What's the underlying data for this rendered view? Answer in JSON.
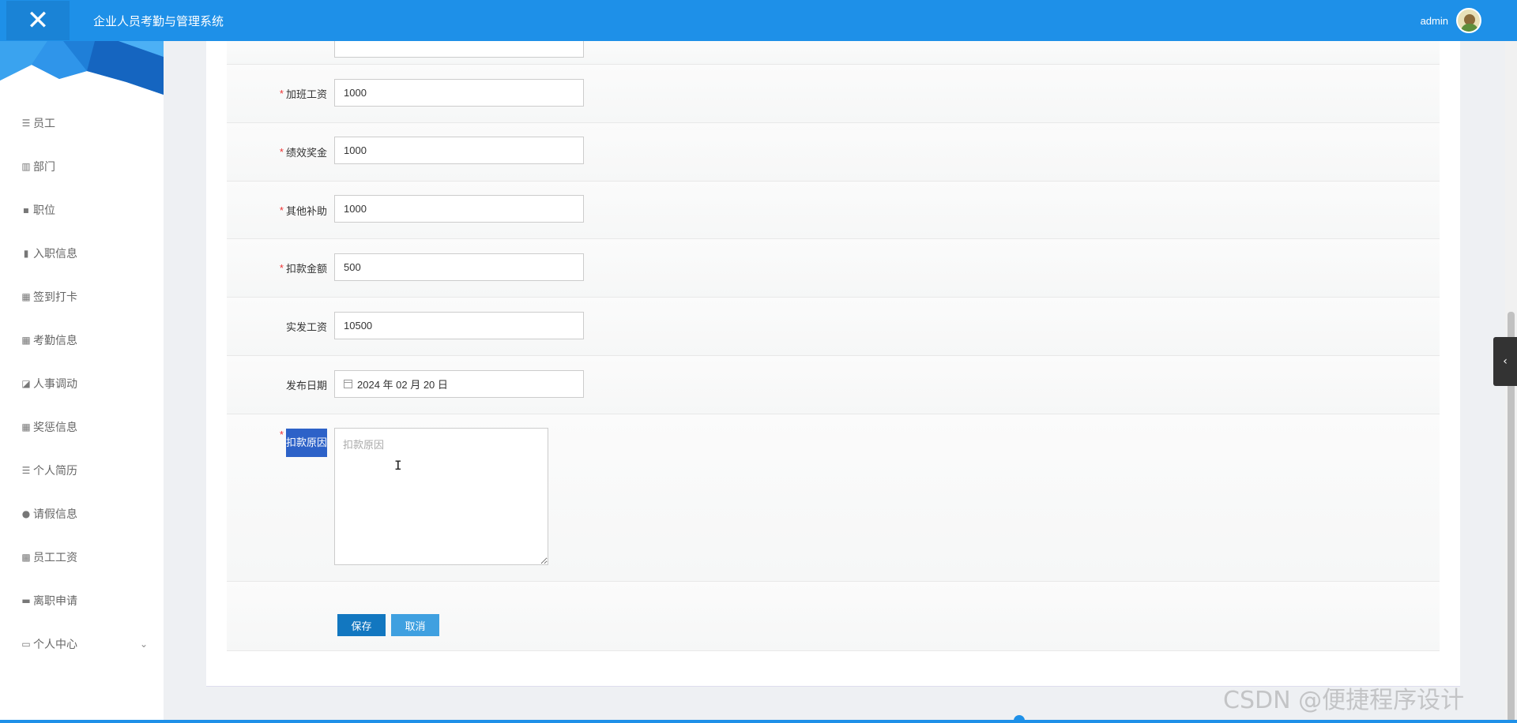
{
  "topbar": {
    "close_icon": "✕",
    "title": "企业人员考勤与管理系统",
    "username": "admin",
    "brand_color": "#1e90e8"
  },
  "sidebar": {
    "items": [
      {
        "label": "员工",
        "icon": "list-icon"
      },
      {
        "label": "部门",
        "icon": "building-icon"
      },
      {
        "label": "职位",
        "icon": "comment-icon"
      },
      {
        "label": "入职信息",
        "icon": "bar-chart-icon"
      },
      {
        "label": "签到打卡",
        "icon": "grid-icon"
      },
      {
        "label": "考勤信息",
        "icon": "grid-icon"
      },
      {
        "label": "人事调动",
        "icon": "area-chart-icon"
      },
      {
        "label": "奖惩信息",
        "icon": "grid-icon"
      },
      {
        "label": "个人简历",
        "icon": "list-icon"
      },
      {
        "label": "请假信息",
        "icon": "user-icon"
      },
      {
        "label": "员工工资",
        "icon": "apps-icon"
      },
      {
        "label": "离职申请",
        "icon": "print-icon"
      },
      {
        "label": "个人中心",
        "icon": "card-icon"
      }
    ]
  },
  "form": {
    "overtime_label": "加班工资",
    "overtime_value": "1000",
    "bonus_label": "绩效奖金",
    "bonus_value": "1000",
    "allowance_label": "其他补助",
    "allowance_value": "1000",
    "deduction_label": "扣款金额",
    "deduction_value": "500",
    "net_label": "实发工资",
    "net_value": "10500",
    "date_label": "发布日期",
    "date_value": "2024 年 02 月 20 日",
    "reason_label": "扣款原因",
    "reason_placeholder": "扣款原因",
    "required_mark": "*",
    "save_label": "保存",
    "cancel_label": "取消"
  },
  "side_tab_icon": "‹",
  "watermark": "CSDN @便捷程序设计"
}
